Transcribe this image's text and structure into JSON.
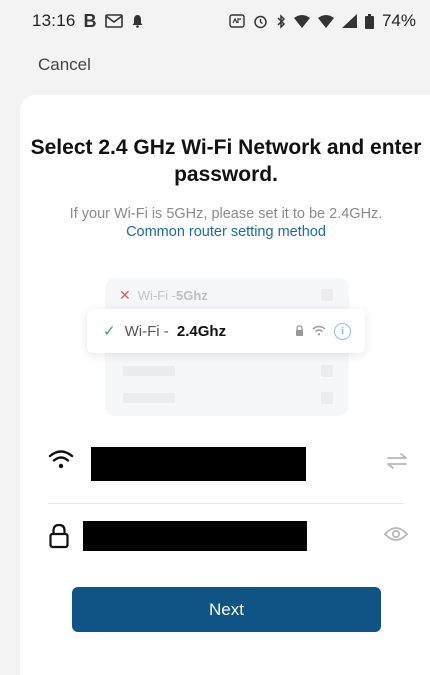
{
  "status_bar": {
    "time": "13:16",
    "left_icons": [
      "b-icon",
      "outlook-icon",
      "notification-bell-icon"
    ],
    "right_icons": [
      "vpn-icon",
      "alarm-icon",
      "bluetooth-icon",
      "wifi-icon",
      "wifi-icon",
      "cell-signal-icon",
      "battery-icon"
    ],
    "b_glyph": "B",
    "battery": "74%"
  },
  "header": {
    "cancel_label": "Cancel"
  },
  "main": {
    "title": "Select 2.4 GHz Wi-Fi Network and enter password.",
    "subtitle": "If your Wi-Fi is 5GHz, please set it to be 2.4GHz.",
    "router_link": "Common router setting method"
  },
  "illustration": {
    "bad_prefix": "Wi-Fi - ",
    "bad_band": "5Ghz",
    "good_prefix": "Wi-Fi - ",
    "good_band": "2.4Ghz"
  },
  "form": {
    "wifi_name": "",
    "password": ""
  },
  "actions": {
    "next_label": "Next"
  },
  "colors": {
    "accent": "#0f5485",
    "link": "#1c6aa8",
    "error": "#e05a5a",
    "ok": "#3aa56d"
  }
}
